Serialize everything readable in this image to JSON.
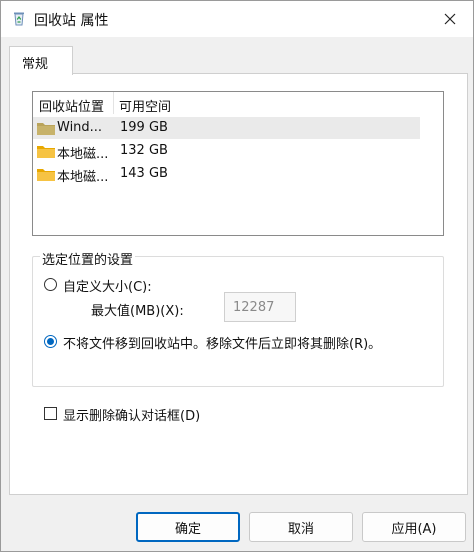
{
  "window": {
    "title": "回收站 属性",
    "title_icon": "recycle-bin-icon",
    "close_icon": "close-icon"
  },
  "tabs": [
    {
      "label": "常规",
      "selected": true
    }
  ],
  "list": {
    "columns": [
      "回收站位置",
      "可用空间"
    ],
    "rows": [
      {
        "name": "Wind...",
        "space": "199 GB",
        "icon": "folder-icon",
        "selected": true
      },
      {
        "name": "本地磁...",
        "space": "132 GB",
        "icon": "folder-icon",
        "selected": false
      },
      {
        "name": "本地磁...",
        "space": "143 GB",
        "icon": "folder-icon",
        "selected": false
      }
    ]
  },
  "settings": {
    "group_label": "选定位置的设置",
    "custom_size_label": "自定义大小(C):",
    "custom_size_checked": false,
    "max_size_label": "最大值(MB)(X):",
    "max_size_value": "12287",
    "no_move_label": "不将文件移到回收站中。移除文件后立即将其删除(R)。",
    "no_move_checked": true
  },
  "confirm": {
    "label": "显示删除确认对话框(D)",
    "checked": false
  },
  "buttons": {
    "ok": "确定",
    "cancel": "取消",
    "apply": "应用(A)"
  },
  "colors": {
    "accent": "#0067c0",
    "folder": "#f6c343"
  }
}
